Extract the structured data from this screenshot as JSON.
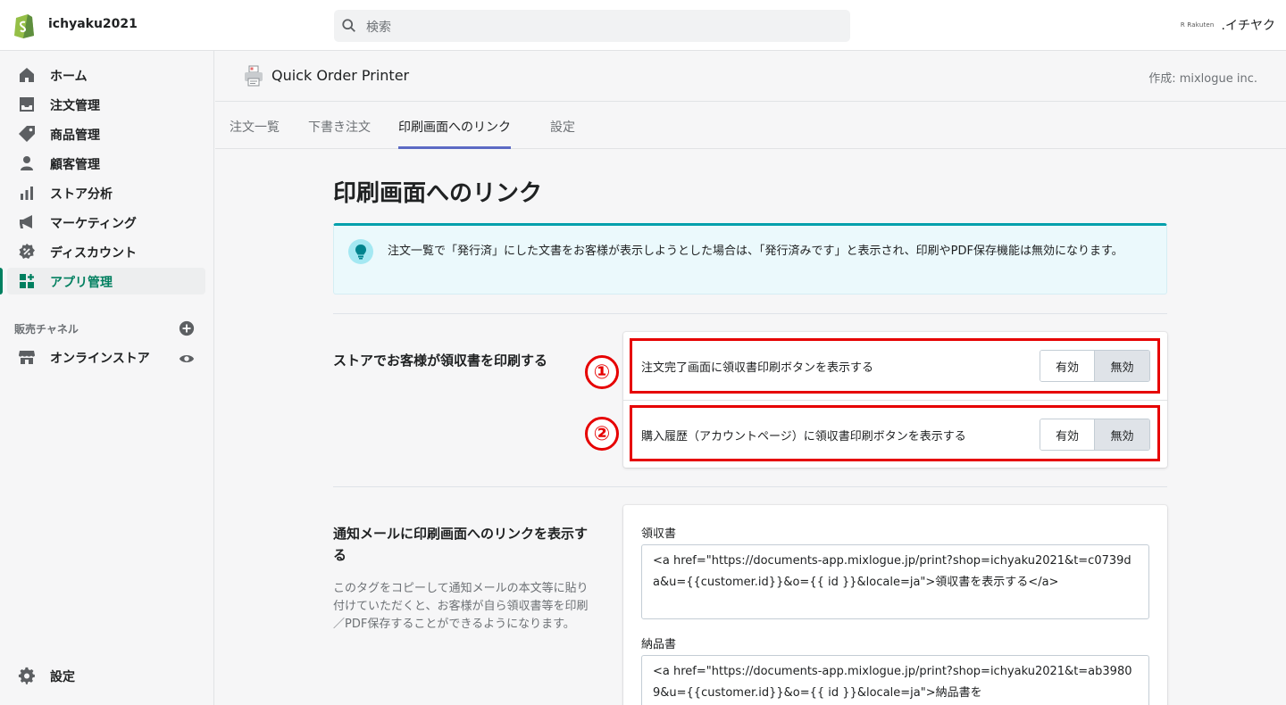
{
  "topbar": {
    "store_name": "ichyaku2021",
    "search_placeholder": "検索",
    "account_brand": "R Rakuten",
    "account_name": ".イチヤク"
  },
  "sidebar": {
    "items": [
      {
        "label": "ホーム",
        "icon": "home-icon"
      },
      {
        "label": "注文管理",
        "icon": "orders-icon"
      },
      {
        "label": "商品管理",
        "icon": "tag-icon"
      },
      {
        "label": "顧客管理",
        "icon": "person-icon"
      },
      {
        "label": "ストア分析",
        "icon": "bar-chart-icon"
      },
      {
        "label": "マーケティング",
        "icon": "megaphone-icon"
      },
      {
        "label": "ディスカウント",
        "icon": "discount-icon"
      },
      {
        "label": "アプリ管理",
        "icon": "apps-icon",
        "active": true
      }
    ],
    "sales_channels_title": "販売チャネル",
    "online_store": "オンラインストア",
    "settings": "設定"
  },
  "app": {
    "title": "Quick Order Printer",
    "author": "作成: mixlogue inc."
  },
  "tabs": [
    {
      "label": "注文一覧"
    },
    {
      "label": "下書き注文"
    },
    {
      "label": "印刷画面へのリンク",
      "active": true
    },
    {
      "label": "設定"
    }
  ],
  "main": {
    "page_title": "印刷画面へのリンク",
    "banner_text": "注文一覧で「発行済」にした文書をお客様が表示しようとした場合は、「発行済みです」と表示され、印刷やPDF保存機能は無効になります。",
    "section1": {
      "title": "ストアでお客様が領収書を印刷する",
      "rows": [
        {
          "num": "①",
          "label": "注文完了画面に領収書印刷ボタンを表示する",
          "on": "有効",
          "off": "無効",
          "selected": "無効"
        },
        {
          "num": "②",
          "label": "購入履歴（アカウントページ）に領収書印刷ボタンを表示する",
          "on": "有効",
          "off": "無効",
          "selected": "無効"
        }
      ]
    },
    "section2": {
      "title": "通知メールに印刷画面へのリンクを表示する",
      "desc": "このタグをコピーして通知メールの本文等に貼り付けていただくと、お客様が自ら領収書等を印刷／PDF保存することができるようになります。",
      "fields": [
        {
          "label": "領収書",
          "value": "<a href=\"https://documents-app.mixlogue.jp/print?shop=ichyaku2021&t=c0739da&u={{customer.id}}&o={{ id }}&locale=ja\">領収書を表示する</a>"
        },
        {
          "label": "納品書",
          "value": "<a href=\"https://documents-app.mixlogue.jp/print?shop=ichyaku2021&t=ab39809&u={{customer.id}}&o={{ id }}&locale=ja\">納品書を"
        }
      ]
    }
  },
  "colors": {
    "accent_green": "#008060",
    "tab_indicator": "#5c6ac4",
    "highlight_red": "#e60000",
    "banner_bg": "#ebf9fc"
  }
}
